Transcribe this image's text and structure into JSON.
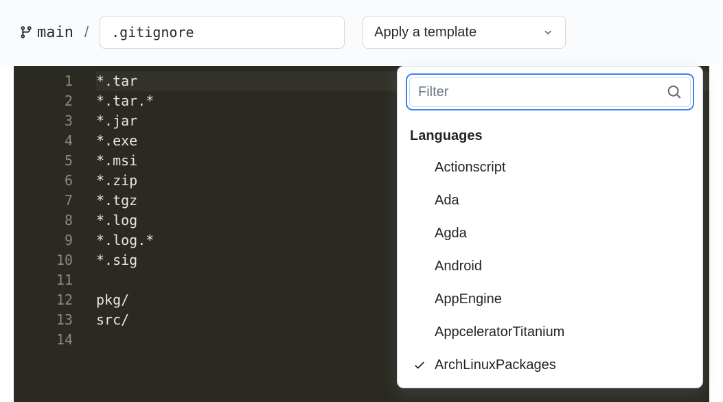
{
  "branch": {
    "name": "main"
  },
  "path_separator": "/",
  "filename": ".gitignore",
  "template_button": {
    "label": "Apply a template"
  },
  "editor": {
    "current_line": 1,
    "lines": [
      "*.tar",
      "*.tar.*",
      "*.jar",
      "*.exe",
      "*.msi",
      "*.zip",
      "*.tgz",
      "*.log",
      "*.log.*",
      "*.sig",
      "",
      "pkg/",
      "src/",
      ""
    ]
  },
  "dropdown": {
    "filter_placeholder": "Filter",
    "heading": "Languages",
    "items": [
      {
        "label": "Actionscript",
        "selected": false
      },
      {
        "label": "Ada",
        "selected": false
      },
      {
        "label": "Agda",
        "selected": false
      },
      {
        "label": "Android",
        "selected": false
      },
      {
        "label": "AppEngine",
        "selected": false
      },
      {
        "label": "AppceleratorTitanium",
        "selected": false
      },
      {
        "label": "ArchLinuxPackages",
        "selected": true
      }
    ]
  }
}
